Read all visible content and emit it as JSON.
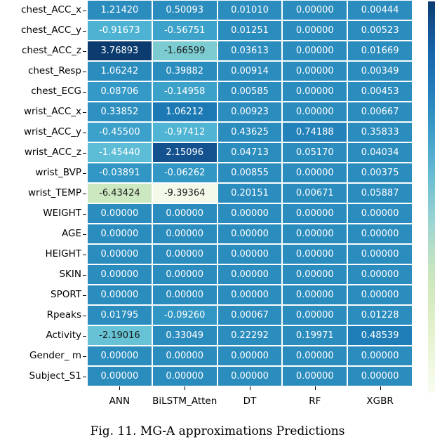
{
  "figure": {
    "caption": "Fig. 11.  MG-A approximations Predictions",
    "colormap": "GnBu_r",
    "colorbar": {
      "present": true,
      "orientation": "vertical",
      "position": "right"
    }
  },
  "chart_data": {
    "type": "heatmap",
    "title": "",
    "xlabel": "",
    "ylabel": "",
    "colormap": "GnBu_r",
    "annot": true,
    "annot_format": "5 decimal places",
    "categories": [
      "ANN",
      "BiLSTM_Atten",
      "DT",
      "RF",
      "XGBR"
    ],
    "rows": [
      "chest_ACC_x",
      "chest_ACC_y",
      "chest_ACC_z",
      "chest_Resp",
      "chest_ECG",
      "wrist_ACC_x",
      "wrist_ACC_y",
      "wrist_ACC_z",
      "wrist_BVP",
      "wrist_TEMP",
      "WEIGHT",
      "AGE",
      "HEIGHT",
      "SKIN",
      "SPORT",
      "Rpeaks",
      "Activity",
      "Gender_ m",
      "Subject_S1"
    ],
    "values": [
      [
        1.2142,
        0.50093,
        0.0101,
        0.0,
        0.00444
      ],
      [
        -0.91673,
        -0.56751,
        0.01251,
        0.0,
        0.00523
      ],
      [
        3.76893,
        -1.66599,
        0.03613,
        0.0,
        0.01669
      ],
      [
        1.06242,
        0.39882,
        0.00914,
        0.0,
        0.00349
      ],
      [
        0.08706,
        -0.14958,
        0.00585,
        0.0,
        0.00453
      ],
      [
        0.33852,
        1.06212,
        0.00923,
        0.0,
        0.00667
      ],
      [
        -0.455,
        -0.97412,
        0.43625,
        0.74188,
        0.35833
      ],
      [
        -1.4544,
        2.15096,
        0.04713,
        0.0517,
        0.04034
      ],
      [
        -0.03891,
        -0.06262,
        0.00855,
        0.0,
        0.00375
      ],
      [
        -6.43424,
        -9.39364,
        0.20151,
        0.00671,
        0.05887
      ],
      [
        0.0,
        0.0,
        0.0,
        0.0,
        0.0
      ],
      [
        0.0,
        0.0,
        0.0,
        0.0,
        0.0
      ],
      [
        0.0,
        0.0,
        0.0,
        0.0,
        0.0
      ],
      [
        0.0,
        0.0,
        0.0,
        0.0,
        0.0
      ],
      [
        0.0,
        0.0,
        0.0,
        0.0,
        0.0
      ],
      [
        0.01795,
        -0.0926,
        0.00067,
        0.0,
        0.01228
      ],
      [
        -2.19016,
        0.33049,
        0.22292,
        0.19971,
        0.48539
      ],
      [
        0.0,
        0.0,
        0.0,
        0.0,
        0.0
      ],
      [
        0.0,
        0.0,
        0.0,
        0.0,
        0.0
      ]
    ],
    "labels": [
      [
        "1.21420",
        "0.50093",
        "0.01010",
        "0.00000",
        "0.00444"
      ],
      [
        "-0.91673",
        "-0.56751",
        "0.01251",
        "0.00000",
        "0.00523"
      ],
      [
        "3.76893",
        "-1.66599",
        "0.03613",
        "0.00000",
        "0.01669"
      ],
      [
        "1.06242",
        "0.39882",
        "0.00914",
        "0.00000",
        "0.00349"
      ],
      [
        "0.08706",
        "-0.14958",
        "0.00585",
        "0.00000",
        "0.00453"
      ],
      [
        "0.33852",
        "1.06212",
        "0.00923",
        "0.00000",
        "0.00667"
      ],
      [
        "-0.45500",
        "-0.97412",
        "0.43625",
        "0.74188",
        "0.35833"
      ],
      [
        "-1.45440",
        "2.15096",
        "0.04713",
        "0.05170",
        "0.04034"
      ],
      [
        "-0.03891",
        "-0.06262",
        "0.00855",
        "0.00000",
        "0.00375"
      ],
      [
        "-6.43424",
        "-9.39364",
        "0.20151",
        "0.00671",
        "0.05887"
      ],
      [
        "0.00000",
        "0.00000",
        "0.00000",
        "0.00000",
        "0.00000"
      ],
      [
        "0.00000",
        "0.00000",
        "0.00000",
        "0.00000",
        "0.00000"
      ],
      [
        "0.00000",
        "0.00000",
        "0.00000",
        "0.00000",
        "0.00000"
      ],
      [
        "0.00000",
        "0.00000",
        "0.00000",
        "0.00000",
        "0.00000"
      ],
      [
        "0.00000",
        "0.00000",
        "0.00000",
        "0.00000",
        "0.00000"
      ],
      [
        "0.01795",
        "-0.09260",
        "0.00067",
        "0.00000",
        "0.01228"
      ],
      [
        "-2.19016",
        "0.33049",
        "0.22292",
        "0.19971",
        "0.48539"
      ],
      [
        "0.00000",
        "0.00000",
        "0.00000",
        "0.00000",
        "0.00000"
      ],
      [
        "0.00000",
        "0.00000",
        "0.00000",
        "0.00000",
        "0.00000"
      ]
    ],
    "cell_colors": [
      [
        "#2b8cbe",
        "#2b8cbe",
        "#2b8cbe",
        "#2b8cbe",
        "#2b8cbe"
      ],
      [
        "#4eb3d3",
        "#3da3cb",
        "#2b8cbe",
        "#2b8cbe",
        "#2b8cbe"
      ],
      [
        "#0b3b6f",
        "#7bcbd0",
        "#2b8cbe",
        "#2b8cbe",
        "#2b8cbe"
      ],
      [
        "#2b8cbe",
        "#2b8cbe",
        "#2b8cbe",
        "#2b8cbe",
        "#2b8cbe"
      ],
      [
        "#3499c6",
        "#3ca2ca",
        "#2b8cbe",
        "#2b8cbe",
        "#2b8cbe"
      ],
      [
        "#2e90c0",
        "#1c79b4",
        "#2b8cbe",
        "#2b8cbe",
        "#2b8cbe"
      ],
      [
        "#3ba1ca",
        "#50b4d4",
        "#2b8cbe",
        "#2482ba",
        "#2b8cbe"
      ],
      [
        "#5dbcd6",
        "#13518f",
        "#2b8cbe",
        "#2b8cbe",
        "#2b8cbe"
      ],
      [
        "#3296c4",
        "#3397c5",
        "#2b8cbe",
        "#2b8cbe",
        "#2b8cbe"
      ],
      [
        "#cbe8c0",
        "#f3faea",
        "#2b8cbe",
        "#2b8cbe",
        "#2b8cbe"
      ],
      [
        "#2b8cbe",
        "#2b8cbe",
        "#2b8cbe",
        "#2b8cbe",
        "#2b8cbe"
      ],
      [
        "#2b8cbe",
        "#2b8cbe",
        "#2b8cbe",
        "#2b8cbe",
        "#2b8cbe"
      ],
      [
        "#2b8cbe",
        "#2b8cbe",
        "#2b8cbe",
        "#2b8cbe",
        "#2b8cbe"
      ],
      [
        "#2b8cbe",
        "#2b8cbe",
        "#2b8cbe",
        "#2b8cbe",
        "#2b8cbe"
      ],
      [
        "#2b8cbe",
        "#2b8cbe",
        "#2b8cbe",
        "#2b8cbe",
        "#2b8cbe"
      ],
      [
        "#2b8cbe",
        "#3196c3",
        "#2b8cbe",
        "#2b8cbe",
        "#2b8cbe"
      ],
      [
        "#66c2d4",
        "#2b8cbe",
        "#2b8cbe",
        "#2b8cbe",
        "#1f7eb7"
      ],
      [
        "#2b8cbe",
        "#2b8cbe",
        "#2b8cbe",
        "#2b8cbe",
        "#2b8cbe"
      ],
      [
        "#2b8cbe",
        "#2b8cbe",
        "#2b8cbe",
        "#2b8cbe",
        "#2b8cbe"
      ]
    ],
    "text_colors": [
      [
        "#ffffff",
        "#ffffff",
        "#ffffff",
        "#ffffff",
        "#ffffff"
      ],
      [
        "#ffffff",
        "#ffffff",
        "#ffffff",
        "#ffffff",
        "#ffffff"
      ],
      [
        "#ffffff",
        "#1a1a1a",
        "#ffffff",
        "#ffffff",
        "#ffffff"
      ],
      [
        "#ffffff",
        "#ffffff",
        "#ffffff",
        "#ffffff",
        "#ffffff"
      ],
      [
        "#ffffff",
        "#ffffff",
        "#ffffff",
        "#ffffff",
        "#ffffff"
      ],
      [
        "#ffffff",
        "#ffffff",
        "#ffffff",
        "#ffffff",
        "#ffffff"
      ],
      [
        "#ffffff",
        "#ffffff",
        "#ffffff",
        "#ffffff",
        "#ffffff"
      ],
      [
        "#ffffff",
        "#ffffff",
        "#ffffff",
        "#ffffff",
        "#ffffff"
      ],
      [
        "#ffffff",
        "#ffffff",
        "#ffffff",
        "#ffffff",
        "#ffffff"
      ],
      [
        "#1a1a1a",
        "#1a1a1a",
        "#ffffff",
        "#ffffff",
        "#ffffff"
      ],
      [
        "#ffffff",
        "#ffffff",
        "#ffffff",
        "#ffffff",
        "#ffffff"
      ],
      [
        "#ffffff",
        "#ffffff",
        "#ffffff",
        "#ffffff",
        "#ffffff"
      ],
      [
        "#ffffff",
        "#ffffff",
        "#ffffff",
        "#ffffff",
        "#ffffff"
      ],
      [
        "#ffffff",
        "#ffffff",
        "#ffffff",
        "#ffffff",
        "#ffffff"
      ],
      [
        "#ffffff",
        "#ffffff",
        "#ffffff",
        "#ffffff",
        "#ffffff"
      ],
      [
        "#ffffff",
        "#ffffff",
        "#ffffff",
        "#ffffff",
        "#ffffff"
      ],
      [
        "#1a1a1a",
        "#ffffff",
        "#ffffff",
        "#ffffff",
        "#ffffff"
      ],
      [
        "#ffffff",
        "#ffffff",
        "#ffffff",
        "#ffffff",
        "#ffffff"
      ],
      [
        "#ffffff",
        "#ffffff",
        "#ffffff",
        "#ffffff",
        "#ffffff"
      ]
    ]
  }
}
